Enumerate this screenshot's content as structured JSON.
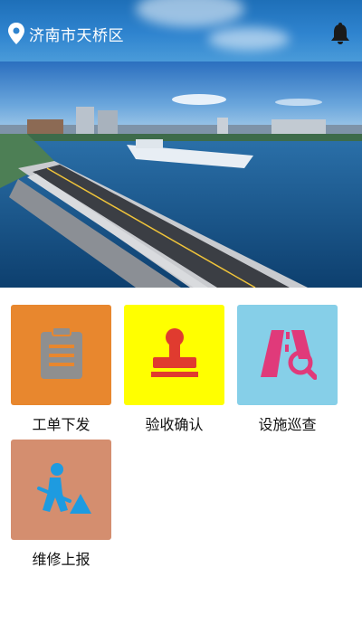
{
  "header": {
    "location": "济南市天桥区",
    "location_icon": "map-pin-icon",
    "notification_icon": "bell-icon"
  },
  "banner": {
    "description_icon": "city-bridge-photo"
  },
  "menu": [
    {
      "label": "工单下发",
      "icon": "clipboard-icon",
      "bg": "#E8872E"
    },
    {
      "label": "验收确认",
      "icon": "stamp-icon",
      "bg": "#FFFF00"
    },
    {
      "label": "设施巡查",
      "icon": "road-search-icon",
      "bg": "#86CFE8"
    },
    {
      "label": "维修上报",
      "icon": "worker-shovel-icon",
      "bg": "#D48E6F"
    }
  ]
}
